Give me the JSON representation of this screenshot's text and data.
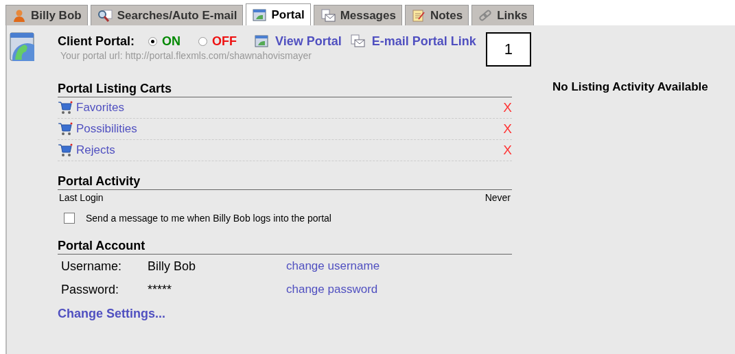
{
  "tabs": [
    {
      "label": "Billy Bob",
      "kind": "person",
      "selected": false
    },
    {
      "label": "Searches/Auto E-mail",
      "kind": "search",
      "selected": false
    },
    {
      "label": "Portal",
      "kind": "portal",
      "selected": true
    },
    {
      "label": "Messages",
      "kind": "message",
      "selected": false
    },
    {
      "label": "Notes",
      "kind": "notes",
      "selected": false
    },
    {
      "label": "Links",
      "kind": "links",
      "selected": false
    }
  ],
  "client_portal": {
    "label": "Client Portal:",
    "options": [
      {
        "label": "ON",
        "selected": true
      },
      {
        "label": "OFF",
        "selected": false
      }
    ],
    "view_link": "View Portal",
    "email_link": "E-mail Portal Link",
    "url_text": "Your portal url: http://portal.flexmls.com/shawnahovismayer"
  },
  "callout": "1",
  "listing_activity": "No Listing Activity Available",
  "carts": {
    "title": "Portal Listing Carts",
    "items": [
      {
        "name": "Favorites",
        "remove": "X"
      },
      {
        "name": "Possibilities",
        "remove": "X"
      },
      {
        "name": "Rejects",
        "remove": "X"
      }
    ]
  },
  "activity": {
    "title": "Portal Activity",
    "last_login_label": "Last Login",
    "last_login_value": "Never",
    "notify": {
      "label": "Send a message to me when Billy Bob logs into the portal",
      "checked": false
    }
  },
  "account": {
    "title": "Portal Account",
    "rows": [
      {
        "label": "Username:",
        "value": "Billy Bob",
        "link": "change username"
      },
      {
        "label": "Password:",
        "value": "*****",
        "link": "change password"
      }
    ],
    "settings_link": "Change Settings..."
  }
}
